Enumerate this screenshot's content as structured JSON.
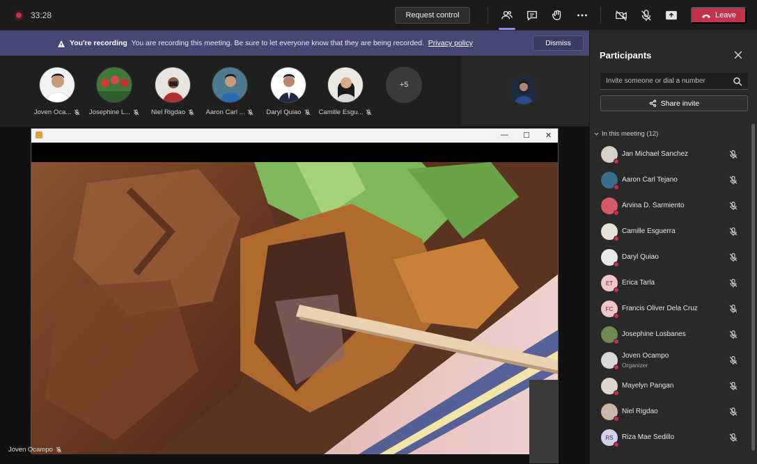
{
  "topbar": {
    "timer": "33:28",
    "request_control": "Request control",
    "leave": "Leave"
  },
  "banner": {
    "title": "You're recording",
    "message": "You are recording this meeting. Be sure to let everyone know that they are being recorded.",
    "link": "Privacy policy",
    "dismiss": "Dismiss"
  },
  "strip": {
    "tiles": [
      {
        "name": "Joven Oca..."
      },
      {
        "name": "Josephine L..."
      },
      {
        "name": "Niel Rigdao"
      },
      {
        "name": "Aaron Carl ..."
      },
      {
        "name": "Daryl Quiao"
      },
      {
        "name": "Camille Esgu..."
      }
    ],
    "more": "+5"
  },
  "stage": {
    "presenter": "Joven Ocampo"
  },
  "panel": {
    "title": "Participants",
    "invite_placeholder": "Invite someone or dial a number",
    "share_invite": "Share invite",
    "section": "In this meeting (12)",
    "participants": [
      {
        "name": "Jan Michael Sanchez",
        "initials": "",
        "color": "#d8d0c4"
      },
      {
        "name": "Aaron Carl Tejano",
        "initials": "",
        "color": "#3b6e8e"
      },
      {
        "name": "Arvina D. Sarmiento",
        "initials": "",
        "color": "#d45a6a"
      },
      {
        "name": "Camille Esguerra",
        "initials": "",
        "color": "#e7e1d8"
      },
      {
        "name": "Daryl Quiao",
        "initials": "",
        "color": "#e9e9e9"
      },
      {
        "name": "Erica Tarla",
        "initials": "ET",
        "color": "#f0c6c6"
      },
      {
        "name": "Francis Oliver Dela Cruz",
        "initials": "FC",
        "color": "#f0c6c6"
      },
      {
        "name": "Josephine Losbanes",
        "initials": "",
        "color": "#6f8a54"
      },
      {
        "name": "Joven Ocampo",
        "role": "Organizer",
        "initials": "",
        "color": "#d9d9d9"
      },
      {
        "name": "Mayelyn Pangan",
        "initials": "",
        "color": "#e0d6cc"
      },
      {
        "name": "Niel Rigdao",
        "initials": "",
        "color": "#c9b8a5"
      },
      {
        "name": "Riza Mae Sedillo",
        "initials": "RS",
        "color": "#cfd3f0"
      }
    ]
  },
  "colors": {
    "banner": "#464775",
    "leave": "#c4314b",
    "accent": "#8b8cf0"
  }
}
